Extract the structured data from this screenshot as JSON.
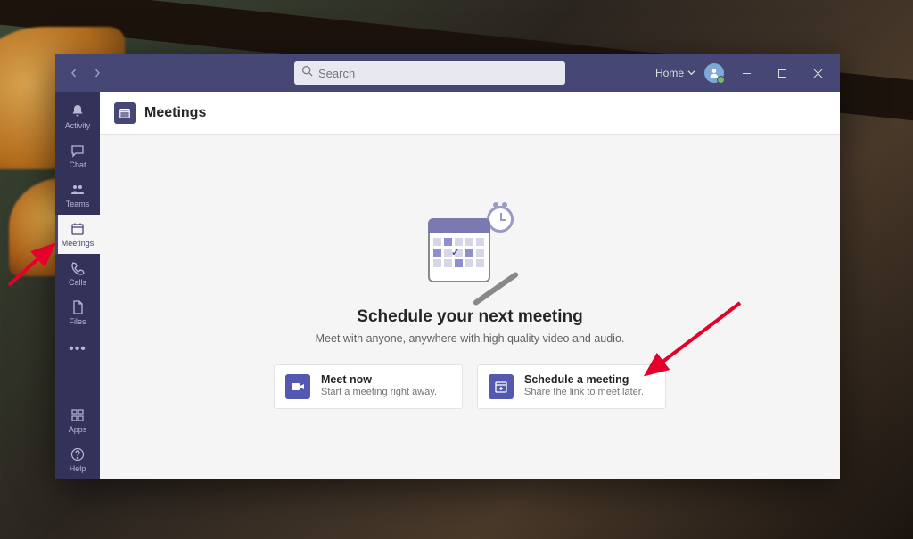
{
  "search": {
    "placeholder": "Search"
  },
  "titlebar": {
    "home_label": "Home"
  },
  "sidebar": {
    "items": [
      {
        "label": "Activity"
      },
      {
        "label": "Chat"
      },
      {
        "label": "Teams"
      },
      {
        "label": "Meetings"
      },
      {
        "label": "Calls"
      },
      {
        "label": "Files"
      }
    ],
    "apps_label": "Apps",
    "help_label": "Help"
  },
  "header": {
    "title": "Meetings"
  },
  "empty": {
    "title": "Schedule your next meeting",
    "subtitle": "Meet with anyone, anywhere with high quality video and audio."
  },
  "actions": {
    "meet_now": {
      "title": "Meet now",
      "subtitle": "Start a meeting right away."
    },
    "schedule": {
      "title": "Schedule a meeting",
      "subtitle": "Share the link to meet later."
    }
  }
}
